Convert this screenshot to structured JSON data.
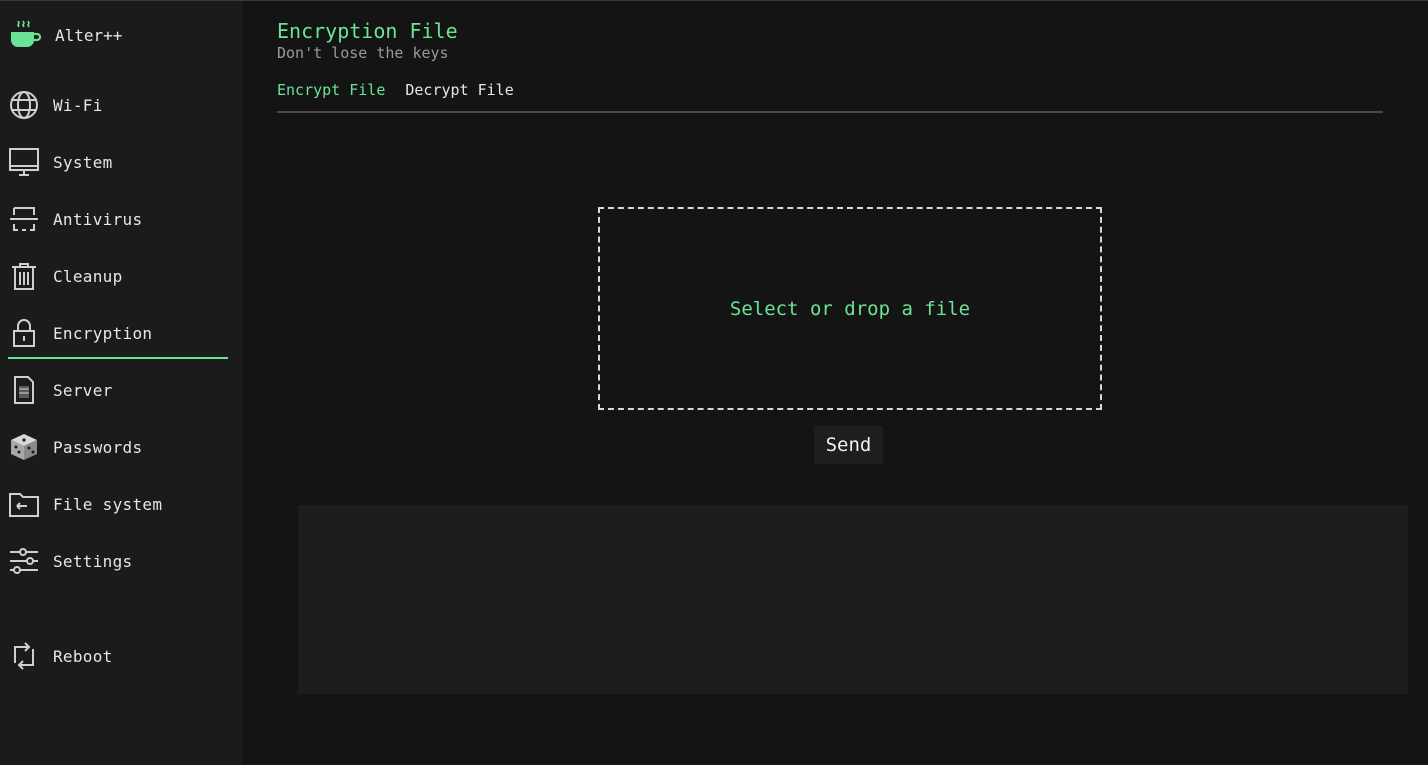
{
  "app": {
    "name": "Alter++"
  },
  "sidebar": {
    "items": [
      {
        "id": "wifi",
        "label": "Wi-Fi",
        "icon": "globe-icon"
      },
      {
        "id": "system",
        "label": "System",
        "icon": "monitor-icon"
      },
      {
        "id": "antivirus",
        "label": "Antivirus",
        "icon": "scanner-icon"
      },
      {
        "id": "cleanup",
        "label": "Cleanup",
        "icon": "trash-icon"
      },
      {
        "id": "encryption",
        "label": "Encryption",
        "icon": "lock-icon",
        "active": true
      },
      {
        "id": "server",
        "label": "Server",
        "icon": "server-file-icon"
      },
      {
        "id": "passwords",
        "label": "Passwords",
        "icon": "dice-icon"
      },
      {
        "id": "filesystem",
        "label": "File system",
        "icon": "folder-icon"
      },
      {
        "id": "settings",
        "label": "Settings",
        "icon": "sliders-icon"
      }
    ],
    "reboot": {
      "label": "Reboot",
      "icon": "reboot-icon"
    }
  },
  "main": {
    "title": "Encryption File",
    "subtitle": "Don't lose the keys",
    "tabs": [
      {
        "label": "Encrypt File",
        "active": true
      },
      {
        "label": "Decrypt File",
        "active": false
      }
    ],
    "dropzone": {
      "text": "Select or drop a file"
    },
    "send_label": "Send",
    "output": ""
  },
  "colors": {
    "accent": "#6be396",
    "background": "#141414",
    "sidebar": "#1b1b1b",
    "panel": "#1d1d1d"
  }
}
